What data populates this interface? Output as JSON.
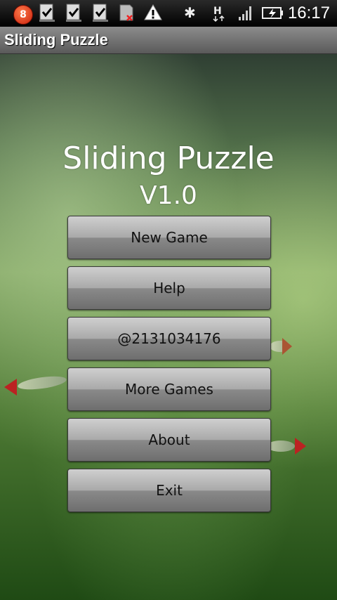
{
  "status_bar": {
    "notification_count": "8",
    "time": "16:17"
  },
  "title_bar": {
    "title": "Sliding Puzzle"
  },
  "main": {
    "heading": "Sliding Puzzle",
    "version": "V1.0",
    "menu": [
      {
        "label": "New Game"
      },
      {
        "label": "Help"
      },
      {
        "label": "@2131034176"
      },
      {
        "label": "More Games"
      },
      {
        "label": "About"
      },
      {
        "label": "Exit"
      }
    ]
  },
  "icons": {
    "notification": "notification-badge-icon",
    "download_done": "download-done-icon",
    "sd_card": "sd-card-removed-icon",
    "warning": "warning-icon",
    "bluetooth": "bluetooth-icon",
    "data": "hspa-data-icon",
    "signal": "signal-icon",
    "battery": "battery-charging-icon"
  }
}
